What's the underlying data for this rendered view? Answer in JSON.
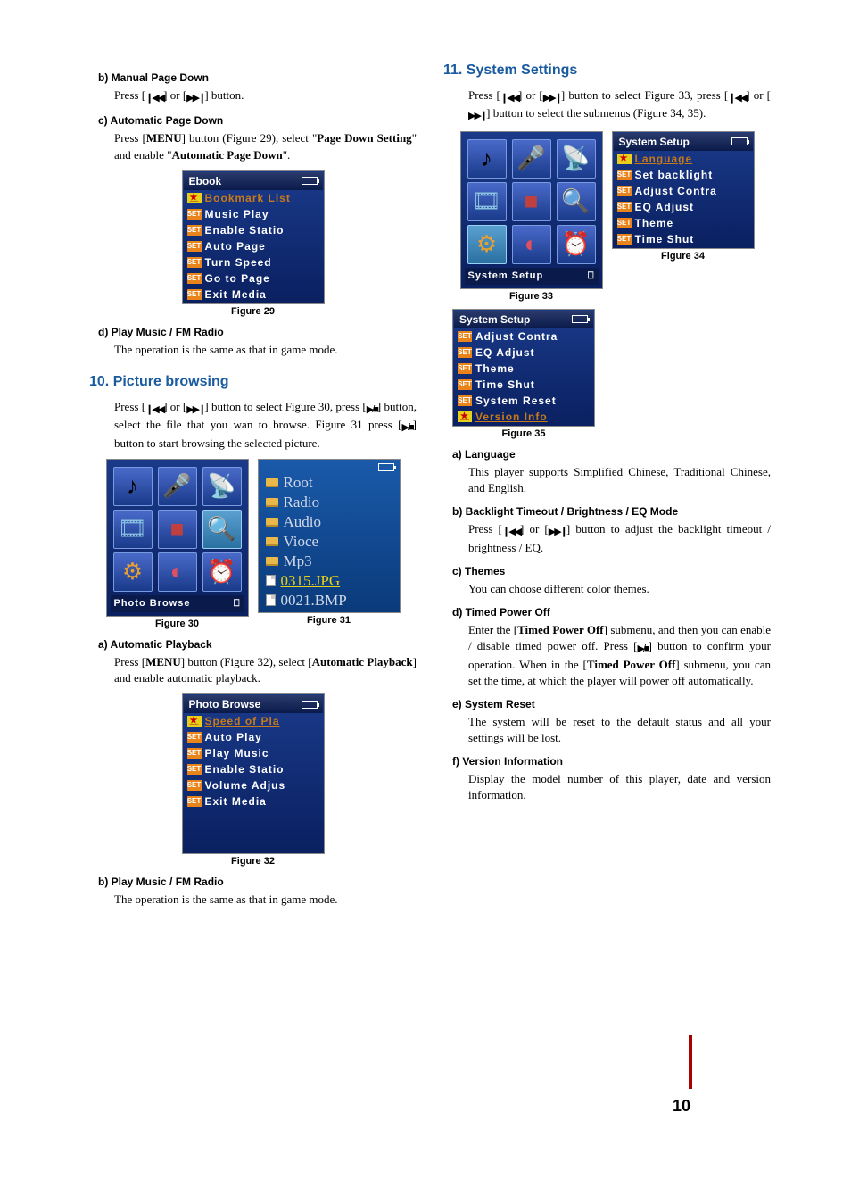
{
  "left": {
    "b_title": "b) Manual Page Down",
    "b_text_pre": "Press [",
    "b_text_mid": "] or [",
    "b_text_post": "] button.",
    "c_title": "c) Automatic Page Down",
    "c_text_1": "Press [",
    "c_menu": "MENU",
    "c_text_2": "] button (Figure 29), select \"",
    "c_bold1": "Page Down Setting",
    "c_text_3": "\" and enable \"",
    "c_bold2": "Automatic Page Down",
    "c_text_4": "\".",
    "fig29": {
      "title": "Ebook",
      "items": [
        "Bookmark List",
        "Music Play",
        "Enable Statio",
        "Auto Page",
        "Turn Speed",
        "Go to Page",
        "Exit Media"
      ],
      "caption": "Figure 29"
    },
    "d_title": "d) Play Music / FM Radio",
    "d_text": "The operation is the same as that in game mode.",
    "h10": "10. Picture browsing",
    "p10_1a": "Press [",
    "p10_1b": "] or [",
    "p10_1c": "] button to select Figure 30, press [",
    "p10_1d": "] button, select the file that you wan to browse. Figure 31 press [",
    "p10_1e": "] button to start browsing the selected picture.",
    "fig30": {
      "footer": "Photo Browse",
      "caption": "Figure 30"
    },
    "fig31": {
      "items": [
        "Root",
        "Radio",
        "Audio",
        "Vioce",
        "Mp3",
        "0315.JPG",
        "0021.BMP"
      ],
      "caption": "Figure 31"
    },
    "a2_title": "a) Automatic Playback",
    "a2_text_1": "Press [",
    "a2_menu": "MENU",
    "a2_text_2": "] button (Figure 32), select [",
    "a2_bold": "Automatic Playback",
    "a2_text_3": "] and enable automatic playback.",
    "fig32": {
      "title": "Photo Browse",
      "items": [
        "Speed of Pla",
        "Auto Play",
        "Play Music",
        "Enable Statio",
        "Volume Adjus",
        "Exit Media"
      ],
      "caption": "Figure 32"
    },
    "b2_title": "b) Play Music / FM Radio",
    "b2_text": "The operation is the same as that in game mode."
  },
  "right": {
    "h11": "11. System Settings",
    "p11_1a": "Press [",
    "p11_1b": "] or [",
    "p11_1c": "] button to select Figure 33, press [",
    "p11_1d": "] or [",
    "p11_1e": "] button to select the submenus (Figure 34, 35).",
    "fig33": {
      "footer": "System Setup",
      "caption": "Figure 33"
    },
    "fig34": {
      "title": "System Setup",
      "items": [
        "Language",
        "Set backlight",
        "Adjust Contra",
        "EQ Adjust",
        "Theme",
        "Time Shut"
      ],
      "caption": "Figure 34"
    },
    "fig35": {
      "title": "System Setup",
      "items": [
        "Adjust Contra",
        "EQ Adjust",
        "Theme",
        "Time Shut",
        "System Reset",
        "Version Info"
      ],
      "caption": "Figure 35"
    },
    "a_title": "a) Language",
    "a_text": "This player supports Simplified Chinese, Traditional Chinese, and English.",
    "b_title": "b) Backlight Timeout / Brightness / EQ Mode",
    "b_text_1": "Press [",
    "b_text_2": "] or [",
    "b_text_3": "] button to adjust the backlight timeout / brightness / EQ.",
    "c_title": "c) Themes",
    "c_text": "You can choose different color themes.",
    "d_title": "d) Timed Power Off",
    "d_text_1": "Enter the [",
    "d_bold1": "Timed Power Off",
    "d_text_2": "] submenu, and then you can enable / disable timed power off. Press [",
    "d_text_3": "] button to confirm your operation. When in the [",
    "d_bold2": "Timed Power Off",
    "d_text_4": "] submenu, you can set the time, at which the player will power off automatically.",
    "e_title": "e) System Reset",
    "e_text": "The system will be reset to the default status and all your settings will be lost.",
    "f_title": "f) Version Information",
    "f_text": "Display the model number of this player, date and version information."
  },
  "page": "10",
  "icons": {
    "prev": "❙◀◀",
    "next": "▶▶❙",
    "playstop": "▶/■"
  }
}
